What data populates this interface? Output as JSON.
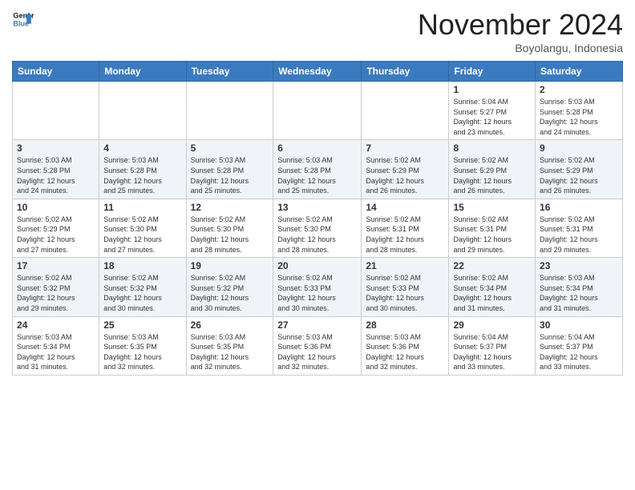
{
  "header": {
    "logo_line1": "General",
    "logo_line2": "Blue",
    "month_title": "November 2024",
    "subtitle": "Boyolangu, Indonesia"
  },
  "days_of_week": [
    "Sunday",
    "Monday",
    "Tuesday",
    "Wednesday",
    "Thursday",
    "Friday",
    "Saturday"
  ],
  "weeks": [
    [
      {
        "day": "",
        "info": ""
      },
      {
        "day": "",
        "info": ""
      },
      {
        "day": "",
        "info": ""
      },
      {
        "day": "",
        "info": ""
      },
      {
        "day": "",
        "info": ""
      },
      {
        "day": "1",
        "info": "Sunrise: 5:04 AM\nSunset: 5:27 PM\nDaylight: 12 hours\nand 23 minutes."
      },
      {
        "day": "2",
        "info": "Sunrise: 5:03 AM\nSunset: 5:28 PM\nDaylight: 12 hours\nand 24 minutes."
      }
    ],
    [
      {
        "day": "3",
        "info": "Sunrise: 5:03 AM\nSunset: 5:28 PM\nDaylight: 12 hours\nand 24 minutes."
      },
      {
        "day": "4",
        "info": "Sunrise: 5:03 AM\nSunset: 5:28 PM\nDaylight: 12 hours\nand 25 minutes."
      },
      {
        "day": "5",
        "info": "Sunrise: 5:03 AM\nSunset: 5:28 PM\nDaylight: 12 hours\nand 25 minutes."
      },
      {
        "day": "6",
        "info": "Sunrise: 5:03 AM\nSunset: 5:28 PM\nDaylight: 12 hours\nand 25 minutes."
      },
      {
        "day": "7",
        "info": "Sunrise: 5:02 AM\nSunset: 5:29 PM\nDaylight: 12 hours\nand 26 minutes."
      },
      {
        "day": "8",
        "info": "Sunrise: 5:02 AM\nSunset: 5:29 PM\nDaylight: 12 hours\nand 26 minutes."
      },
      {
        "day": "9",
        "info": "Sunrise: 5:02 AM\nSunset: 5:29 PM\nDaylight: 12 hours\nand 26 minutes."
      }
    ],
    [
      {
        "day": "10",
        "info": "Sunrise: 5:02 AM\nSunset: 5:29 PM\nDaylight: 12 hours\nand 27 minutes."
      },
      {
        "day": "11",
        "info": "Sunrise: 5:02 AM\nSunset: 5:30 PM\nDaylight: 12 hours\nand 27 minutes."
      },
      {
        "day": "12",
        "info": "Sunrise: 5:02 AM\nSunset: 5:30 PM\nDaylight: 12 hours\nand 28 minutes."
      },
      {
        "day": "13",
        "info": "Sunrise: 5:02 AM\nSunset: 5:30 PM\nDaylight: 12 hours\nand 28 minutes."
      },
      {
        "day": "14",
        "info": "Sunrise: 5:02 AM\nSunset: 5:31 PM\nDaylight: 12 hours\nand 28 minutes."
      },
      {
        "day": "15",
        "info": "Sunrise: 5:02 AM\nSunset: 5:31 PM\nDaylight: 12 hours\nand 29 minutes."
      },
      {
        "day": "16",
        "info": "Sunrise: 5:02 AM\nSunset: 5:31 PM\nDaylight: 12 hours\nand 29 minutes."
      }
    ],
    [
      {
        "day": "17",
        "info": "Sunrise: 5:02 AM\nSunset: 5:32 PM\nDaylight: 12 hours\nand 29 minutes."
      },
      {
        "day": "18",
        "info": "Sunrise: 5:02 AM\nSunset: 5:32 PM\nDaylight: 12 hours\nand 30 minutes."
      },
      {
        "day": "19",
        "info": "Sunrise: 5:02 AM\nSunset: 5:32 PM\nDaylight: 12 hours\nand 30 minutes."
      },
      {
        "day": "20",
        "info": "Sunrise: 5:02 AM\nSunset: 5:33 PM\nDaylight: 12 hours\nand 30 minutes."
      },
      {
        "day": "21",
        "info": "Sunrise: 5:02 AM\nSunset: 5:33 PM\nDaylight: 12 hours\nand 30 minutes."
      },
      {
        "day": "22",
        "info": "Sunrise: 5:02 AM\nSunset: 5:34 PM\nDaylight: 12 hours\nand 31 minutes."
      },
      {
        "day": "23",
        "info": "Sunrise: 5:03 AM\nSunset: 5:34 PM\nDaylight: 12 hours\nand 31 minutes."
      }
    ],
    [
      {
        "day": "24",
        "info": "Sunrise: 5:03 AM\nSunset: 5:34 PM\nDaylight: 12 hours\nand 31 minutes."
      },
      {
        "day": "25",
        "info": "Sunrise: 5:03 AM\nSunset: 5:35 PM\nDaylight: 12 hours\nand 32 minutes."
      },
      {
        "day": "26",
        "info": "Sunrise: 5:03 AM\nSunset: 5:35 PM\nDaylight: 12 hours\nand 32 minutes."
      },
      {
        "day": "27",
        "info": "Sunrise: 5:03 AM\nSunset: 5:36 PM\nDaylight: 12 hours\nand 32 minutes."
      },
      {
        "day": "28",
        "info": "Sunrise: 5:03 AM\nSunset: 5:36 PM\nDaylight: 12 hours\nand 32 minutes."
      },
      {
        "day": "29",
        "info": "Sunrise: 5:04 AM\nSunset: 5:37 PM\nDaylight: 12 hours\nand 33 minutes."
      },
      {
        "day": "30",
        "info": "Sunrise: 5:04 AM\nSunset: 5:37 PM\nDaylight: 12 hours\nand 33 minutes."
      }
    ]
  ]
}
